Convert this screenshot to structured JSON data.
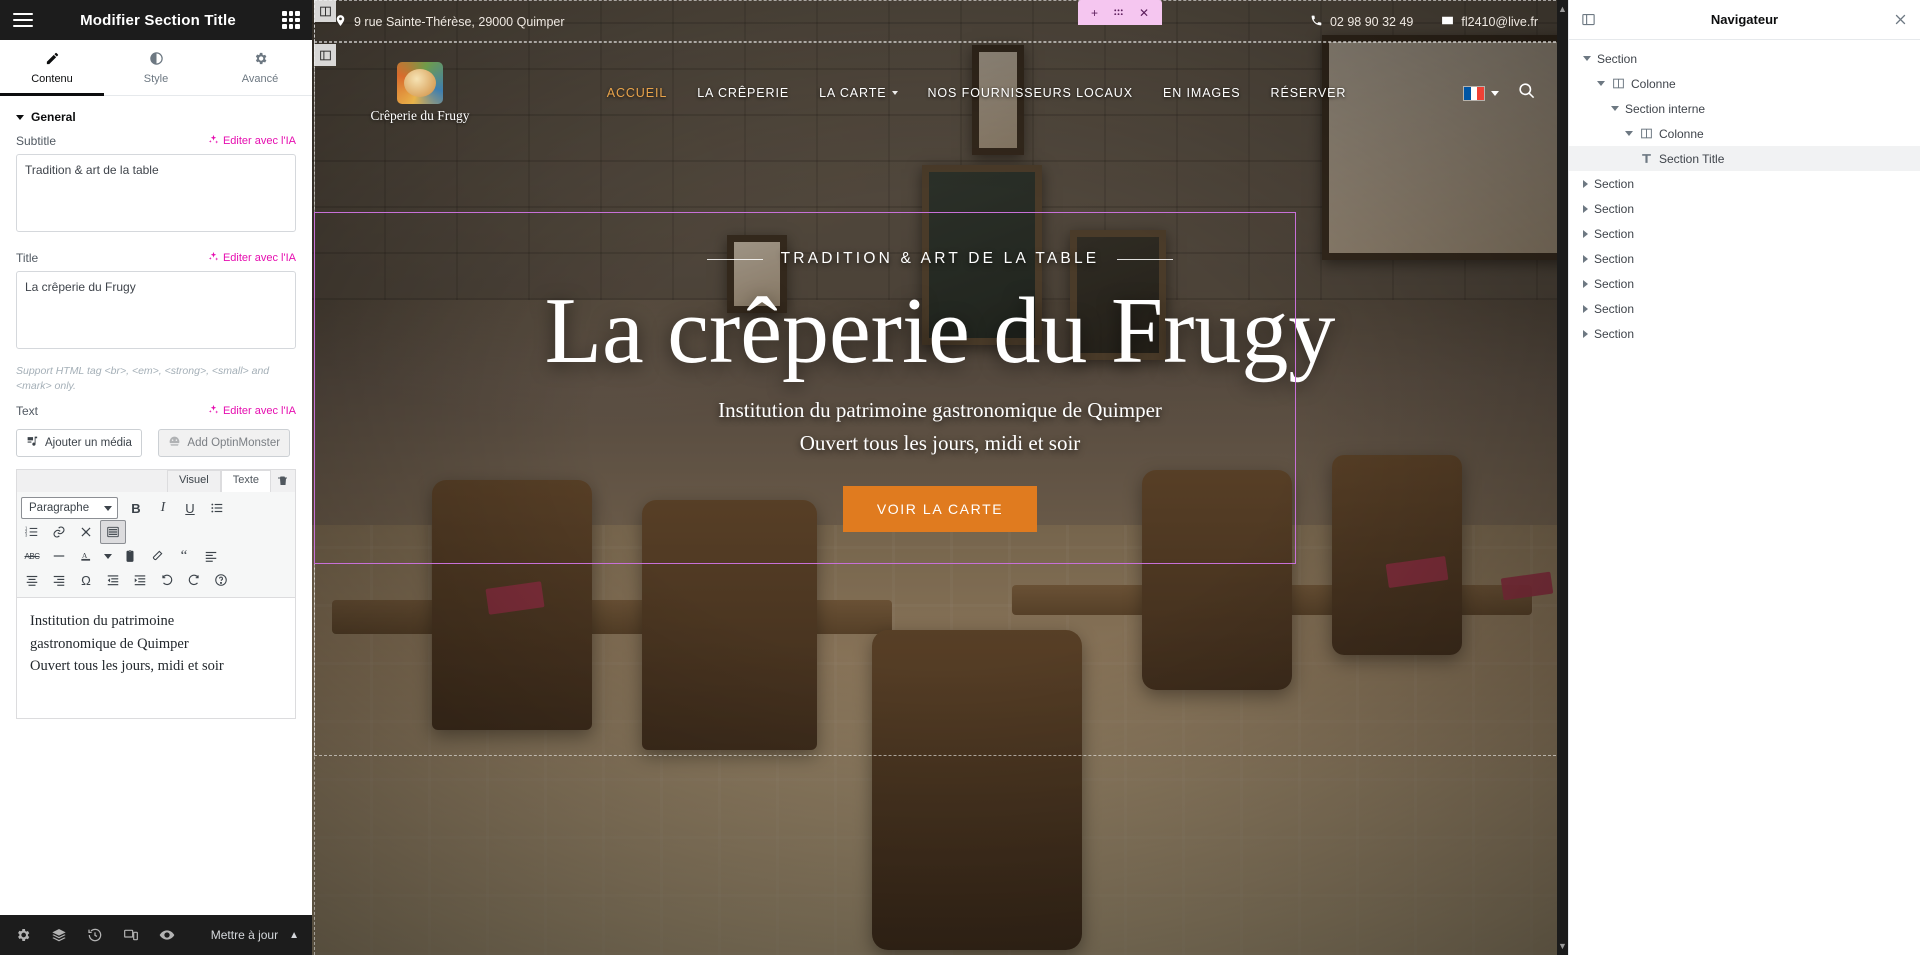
{
  "editor_panel": {
    "title": "Modifier Section Title",
    "menu_icon": "hamburger-icon",
    "apps_icon": "grid-dots-icon",
    "tabs": [
      {
        "label": "Contenu",
        "icon": "pencil-icon",
        "active": true
      },
      {
        "label": "Style",
        "icon": "contrast-icon",
        "active": false
      },
      {
        "label": "Avancé",
        "icon": "gear-icon",
        "active": false
      }
    ],
    "section": {
      "label": "General",
      "expanded": true
    },
    "fields": {
      "subtitle": {
        "label": "Subtitle",
        "ai_label": "Editer avec l'IA",
        "value": "Tradition & art de la table"
      },
      "title": {
        "label": "Title",
        "ai_label": "Editer avec l'IA",
        "value": "La crêperie du Frugy",
        "hint": "Support HTML tag <br>, <em>, <strong>, <small> and <mark> only."
      },
      "text": {
        "label": "Text",
        "ai_label": "Editer avec l'IA",
        "add_media_label": "Ajouter un média",
        "add_optinmonster_label": "Add OptinMonster",
        "editor_tabs": [
          {
            "label": "Visuel",
            "active": true
          },
          {
            "label": "Texte",
            "active": false
          }
        ],
        "format_select": "Paragraphe",
        "toolbar_rows": [
          [
            {
              "icon": "bold-icon",
              "label": "B"
            },
            {
              "icon": "italic-icon",
              "label": "I"
            },
            {
              "icon": "underline-icon",
              "label": "U"
            },
            {
              "icon": "bullet-list-icon",
              "label": ""
            }
          ],
          [
            {
              "icon": "numbered-list-icon",
              "label": ""
            },
            {
              "icon": "link-icon",
              "label": ""
            },
            {
              "icon": "read-more-icon",
              "label": ""
            },
            {
              "icon": "toolbar-toggle-icon",
              "label": "",
              "pressed": true
            }
          ],
          [
            {
              "icon": "strikethrough-icon",
              "label": "ABC"
            },
            {
              "icon": "horizontal-rule-icon",
              "label": ""
            },
            {
              "icon": "text-color-icon",
              "label": "A"
            },
            {
              "icon": "color-dropdown-icon",
              "label": ""
            },
            {
              "icon": "paste-text-icon",
              "label": ""
            },
            {
              "icon": "clear-formatting-icon",
              "label": ""
            },
            {
              "icon": "blockquote-icon",
              "label": ""
            },
            {
              "icon": "align-left-icon",
              "label": ""
            }
          ],
          [
            {
              "icon": "align-center-icon",
              "label": ""
            },
            {
              "icon": "align-right-icon",
              "label": ""
            },
            {
              "icon": "special-character-icon",
              "label": "Ω"
            },
            {
              "icon": "outdent-icon",
              "label": ""
            },
            {
              "icon": "indent-icon",
              "label": ""
            },
            {
              "icon": "undo-icon",
              "label": ""
            },
            {
              "icon": "redo-icon",
              "label": ""
            },
            {
              "icon": "keyboard-shortcuts-icon",
              "label": "?"
            }
          ]
        ],
        "content_lines": [
          "Institution du patrimoine",
          "gastronomique de Quimper",
          "Ouvert tous les jours, midi et soir"
        ]
      }
    },
    "footer": {
      "icons": [
        "settings-gear-icon",
        "layers-icon",
        "history-clock-icon",
        "responsive-device-icon",
        "preview-eye-icon"
      ],
      "update_label": "Mettre à jour",
      "update_caret": "caret-up-icon"
    },
    "collapse_handle": "collapse-panel-icon"
  },
  "preview": {
    "topbar": {
      "address_icon": "map-pin-icon",
      "address": "9 rue Sainte-Thérèse, 29000 Quimper",
      "phone_icon": "phone-icon",
      "phone": "02 98 90 32 49",
      "email_icon": "envelope-icon",
      "email": "fl2410@live.fr"
    },
    "brand": {
      "logo_icon": "crepe-plate-logo",
      "name": "Crêperie du Frugy"
    },
    "nav_items": [
      {
        "label": "ACCUEIL",
        "current": true,
        "dropdown": false
      },
      {
        "label": "LA CRÊPERIE",
        "current": false,
        "dropdown": false
      },
      {
        "label": "LA CARTE",
        "current": false,
        "dropdown": true
      },
      {
        "label": "NOS FOURNISSEURS LOCAUX",
        "current": false,
        "dropdown": false
      },
      {
        "label": "EN IMAGES",
        "current": false,
        "dropdown": false
      },
      {
        "label": "RÉSERVER",
        "current": false,
        "dropdown": false
      }
    ],
    "language_flag": "france-flag-icon",
    "language_caret": "chevron-down-icon",
    "search_icon": "search-icon",
    "hero": {
      "subtitle": "TRADITION & ART DE LA TABLE",
      "title": "La crêperie du Frugy",
      "paragraph1": "Institution du patrimoine gastronomique de Quimper",
      "paragraph2": "Ouvert tous les jours, midi et soir",
      "cta_label": "VOIR LA CARTE"
    },
    "section_toolbar": {
      "add_icon": "plus-icon",
      "drag_icon": "drag-handle-icon",
      "close_icon": "close-x-icon"
    },
    "column_handle_icon": "column-handle-icon",
    "edit_handle_icon": "section-edit-icon",
    "accent_color": "#e07b1f",
    "selection_color": "#c770d8"
  },
  "navigator": {
    "panel_icon": "navigator-icon",
    "title": "Navigateur",
    "close_icon": "close-x-icon",
    "tree": [
      {
        "label": "Section",
        "depth": 0,
        "expanded": true,
        "icon": null,
        "selected": false
      },
      {
        "label": "Colonne",
        "depth": 1,
        "expanded": true,
        "icon": "column-icon",
        "selected": false
      },
      {
        "label": "Section interne",
        "depth": 2,
        "expanded": true,
        "icon": null,
        "selected": false
      },
      {
        "label": "Colonne",
        "depth": 3,
        "expanded": true,
        "icon": "column-icon",
        "selected": false
      },
      {
        "label": "Section Title",
        "depth": 4,
        "expanded": false,
        "icon": "title-icon",
        "selected": true
      },
      {
        "label": "Section",
        "depth": 0,
        "expanded": false,
        "icon": null,
        "selected": false
      },
      {
        "label": "Section",
        "depth": 0,
        "expanded": false,
        "icon": null,
        "selected": false
      },
      {
        "label": "Section",
        "depth": 0,
        "expanded": false,
        "icon": null,
        "selected": false
      },
      {
        "label": "Section",
        "depth": 0,
        "expanded": false,
        "icon": null,
        "selected": false
      },
      {
        "label": "Section",
        "depth": 0,
        "expanded": false,
        "icon": null,
        "selected": false
      },
      {
        "label": "Section",
        "depth": 0,
        "expanded": false,
        "icon": null,
        "selected": false
      },
      {
        "label": "Section",
        "depth": 0,
        "expanded": false,
        "icon": null,
        "selected": false
      }
    ]
  }
}
